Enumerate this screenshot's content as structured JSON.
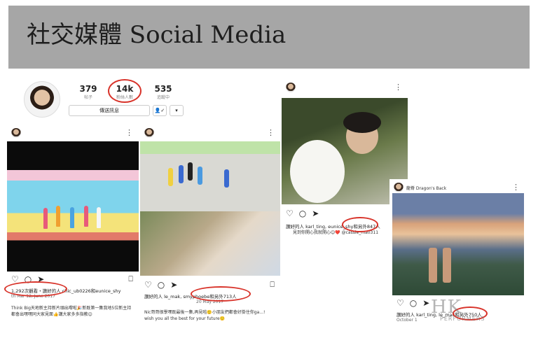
{
  "slide": {
    "title": "社交媒體 Social Media"
  },
  "profile": {
    "posts_count": "379",
    "posts_label": "帖子",
    "followers_count": "14k",
    "followers_label": "粉絲人數",
    "following_count": "535",
    "following_label": "追蹤中",
    "message_button": "傳送訊息",
    "follow_icon": "person-check-icon",
    "dropdown_icon": "chevron-down-icon"
  },
  "post1": {
    "likes": "1,292次觀看・讚好的人 chic_ub0226和eunice_shy",
    "caption_line1": "Think Big天地新主持新片頭出嚟啦🎉新既第一集我地5位新主持",
    "caption_line2": "都會出嘿嘿同大家見面👍講大家多多指教😊",
    "date": "th Mar 12, June 2017"
  },
  "post2": {
    "likes": "讚好的人 le_mak, smyphoebe和另外713人",
    "date": "20 May 2017",
    "caption_line1": "Nic哥哥很學嘿既最後一集,再見啦🙂小朋友們都會好掛住你ga...!",
    "caption_line2": "wish you all the best for your future🙂"
  },
  "post3": {
    "likes": "讚好的人 karl_ting, eunice_shy和另外847人",
    "caption": "見到你開心我就開心😊❤️ @cassie_ma0311"
  },
  "post4": {
    "location": "龍脊 Dragon's Back",
    "likes": "讚好的人 karl_ting, le_mak和另外750人",
    "date": "October 1"
  },
  "watermark": {
    "main": "HK",
    "sub": "PERFORMERS"
  },
  "colors": {
    "header_bg": "#a6a6a6",
    "highlight_ring": "#d8332a"
  }
}
